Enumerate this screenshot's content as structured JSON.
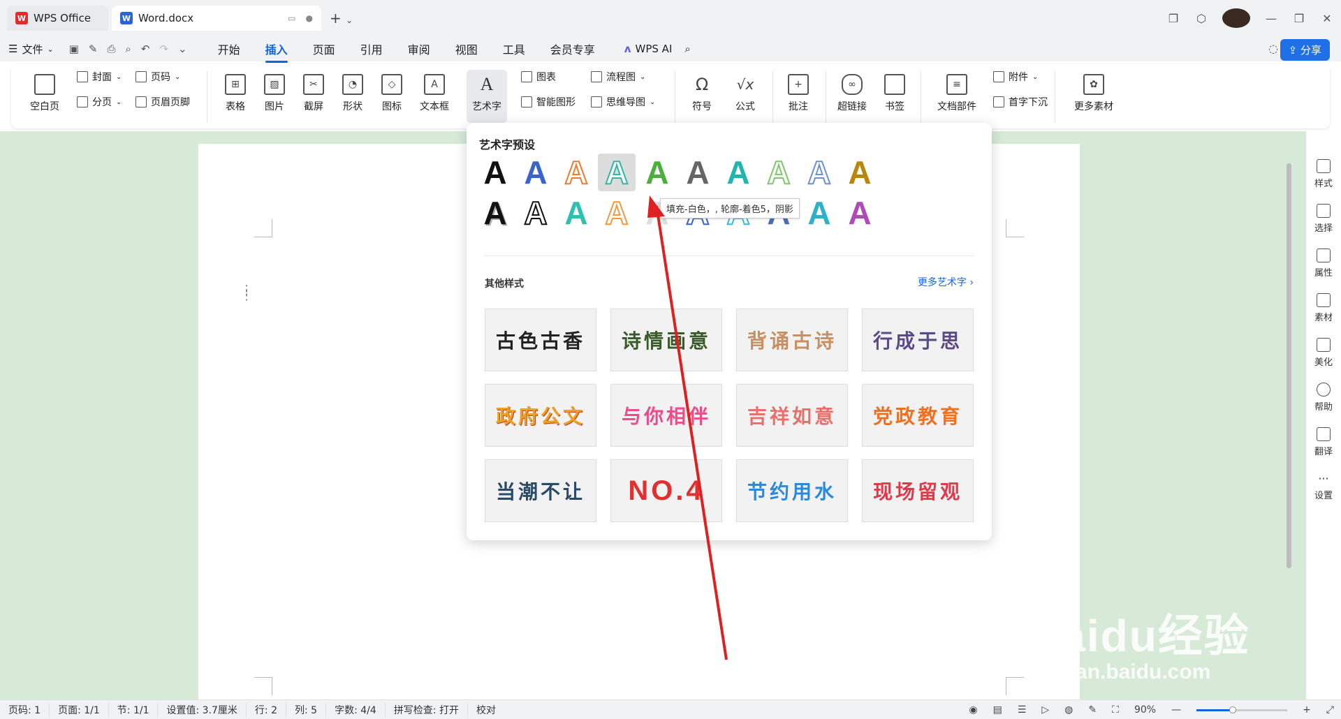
{
  "window": {
    "tab_wps": "WPS Office",
    "tab_doc": "Word.docx"
  },
  "menu": {
    "file": "文件",
    "tabs": [
      "开始",
      "插入",
      "页面",
      "引用",
      "审阅",
      "视图",
      "工具",
      "会员专享"
    ],
    "active_tab": "插入",
    "wps_ai": "WPS AI",
    "share": "分享"
  },
  "ribbon": {
    "blank_page": "空白页",
    "cover": "封面",
    "page_number": "页码",
    "page_break": "分页",
    "header_footer": "页眉页脚",
    "table": "表格",
    "picture": "图片",
    "screenshot": "截屏",
    "shape": "形状",
    "icon": "图标",
    "textbox": "文本框",
    "wordart": "艺术字",
    "chart": "图表",
    "smart_graphic": "智能图形",
    "flowchart": "流程图",
    "mindmap": "思维导图",
    "symbol": "符号",
    "formula": "公式",
    "comment": "批注",
    "hyperlink": "超链接",
    "bookmark": "书签",
    "doc_parts": "文档部件",
    "attachment": "附件",
    "drop_cap": "首字下沉",
    "more_material": "更多素材"
  },
  "panel": {
    "preset_title": "艺术字预设",
    "glyph_letter": "A",
    "tooltip": "填充-白色，, 轮廓-着色5，阴影",
    "other_title": "其他样式",
    "more_link": "更多艺术字",
    "styles": [
      "古色古香",
      "诗情画意",
      "背诵古诗",
      "行成于思",
      "政府公文",
      "与你相伴",
      "吉祥如意",
      "党政教育",
      "当潮不让",
      "NO.4",
      "节约用水",
      "现场留观"
    ]
  },
  "sidebar": [
    "样式",
    "选择",
    "属性",
    "素材",
    "美化",
    "帮助",
    "翻译",
    "设置"
  ],
  "status": {
    "page_no": "页码: 1",
    "pages": "页面: 1/1",
    "section": "节: 1/1",
    "setting": "设置值: 3.7厘米",
    "row": "行: 2",
    "col": "列: 5",
    "words": "字数: 4/4",
    "spell": "拼写检查: 打开",
    "proof": "校对",
    "zoom": "90%"
  },
  "watermark": {
    "main": "Baidu经验",
    "sub": "jingyan.baidu.com"
  }
}
